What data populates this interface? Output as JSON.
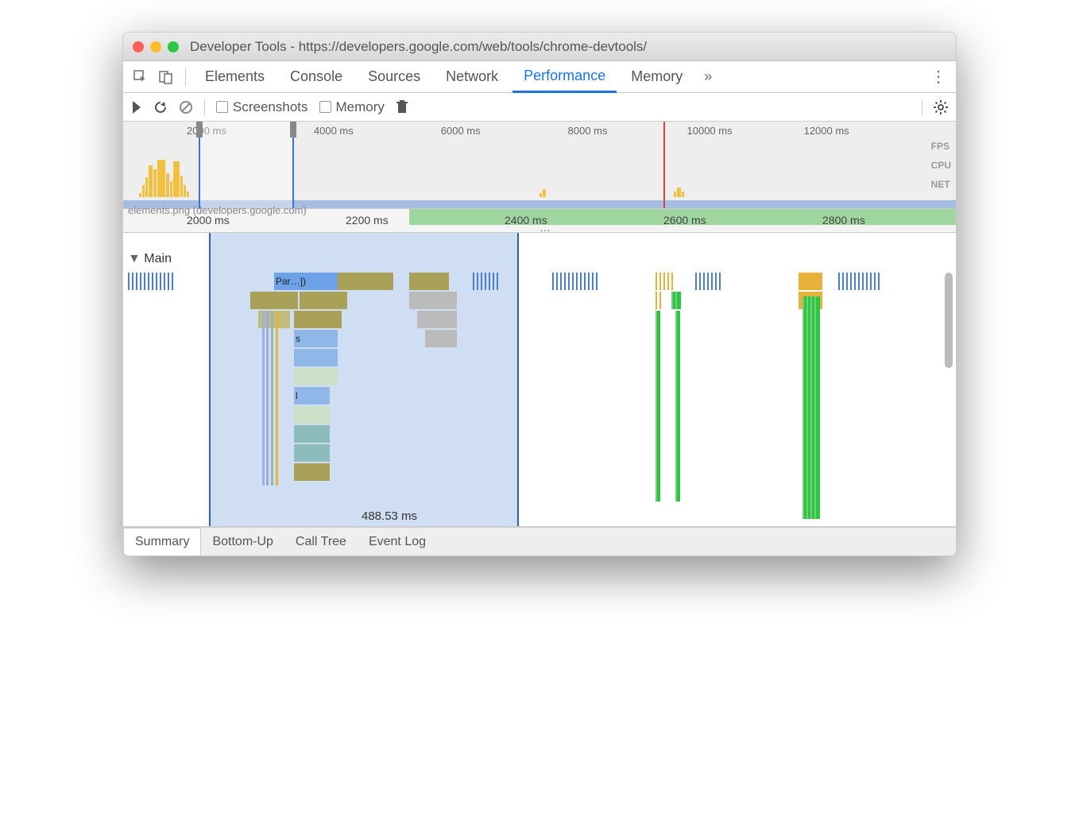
{
  "window": {
    "title": "Developer Tools - https://developers.google.com/web/tools/chrome-devtools/"
  },
  "tabs": {
    "items": [
      "Elements",
      "Console",
      "Sources",
      "Network",
      "Performance",
      "Memory"
    ],
    "active": 4
  },
  "toolbar": {
    "screenshots_label": "Screenshots",
    "memory_label": "Memory"
  },
  "overview": {
    "ticks": [
      "2000 ms",
      "4000 ms",
      "6000 ms",
      "8000 ms",
      "10000 ms",
      "12000 ms"
    ],
    "lanes": [
      "FPS",
      "CPU",
      "NET"
    ],
    "net_label": "elements.png (developers.google.com)"
  },
  "ruler": {
    "ticks": [
      "2000 ms",
      "2200 ms",
      "2400 ms",
      "2600 ms",
      "2800 ms"
    ],
    "ellipsis": "…"
  },
  "flame": {
    "track": "Main",
    "selection_label": "488.53 ms",
    "blocks": {
      "parse": "Par…])",
      "s": "s",
      "l": "l"
    }
  },
  "bottom": {
    "tabs": [
      "Summary",
      "Bottom-Up",
      "Call Tree",
      "Event Log"
    ],
    "active": 0
  }
}
